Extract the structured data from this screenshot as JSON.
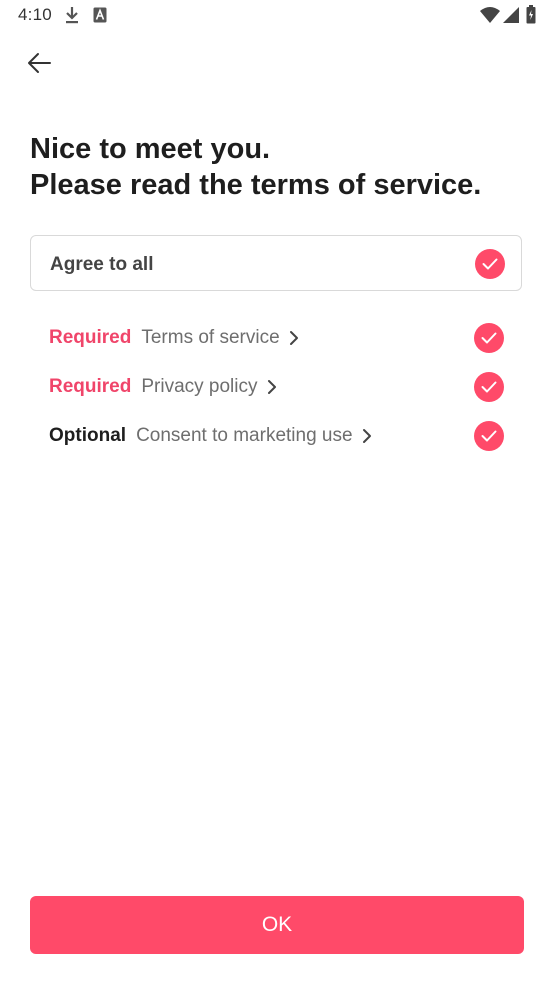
{
  "status_bar": {
    "time": "4:10",
    "icons": [
      "download-icon",
      "a-badge-icon",
      "wifi-icon",
      "signal-icon",
      "battery-icon"
    ]
  },
  "header": {
    "back_icon": "arrow-left-icon"
  },
  "heading": {
    "line1": "Nice to meet you.",
    "line2": "Please read the terms of service."
  },
  "agree_all": {
    "label": "Agree to all",
    "checked": true
  },
  "terms": [
    {
      "tag": "Required",
      "title": "Terms of service",
      "checked": true
    },
    {
      "tag": "Required",
      "title": "Privacy policy",
      "checked": true
    },
    {
      "tag": "Optional",
      "title": "Consent to marketing use",
      "checked": true
    }
  ],
  "ok_button": {
    "label": "OK"
  },
  "colors": {
    "accent": "#ff4a69",
    "required_tag": "#f0456a",
    "text_dark": "#1e1e1e",
    "text_gray": "#6e6e6e",
    "border": "#d9d9d9"
  }
}
